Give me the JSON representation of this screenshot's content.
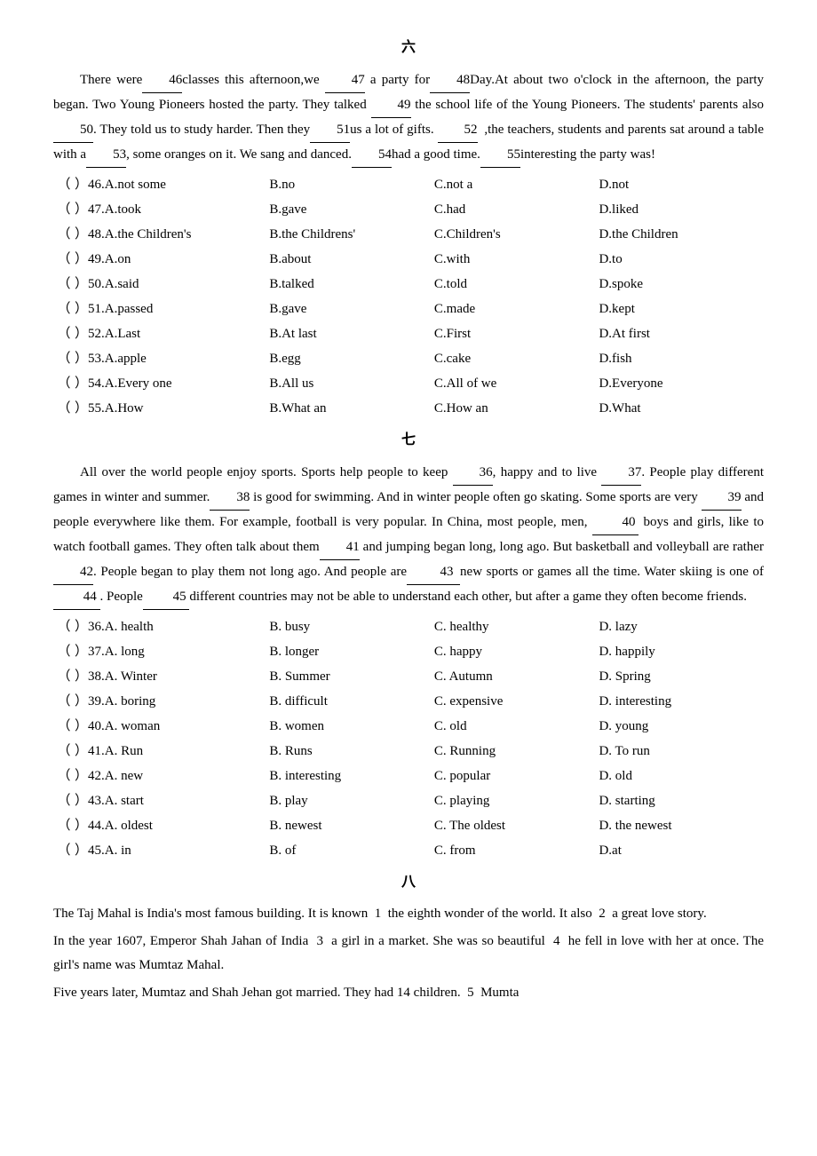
{
  "sections": [
    {
      "id": "liu",
      "title": "六",
      "passage": [
        "There were 46 classes this afternoon,we 47 a party for 48 Day.At about two o'clock in the afternoon, the party began. Two Young Pioneers hosted the party. They talked 49 the school life of the Young Pioneers. The students' parents also 50 . They told us to study harder. Then they 51 us a lot of gifts. 52 ,the teachers, students and parents sat around a table with a 53 , some oranges on it. We sang and danced. 54had a good time. 55 interesting the party was!"
      ],
      "questions": [
        {
          "num": ")46.",
          "options": [
            "A.not some",
            "B.no",
            "C.not a",
            "D.not"
          ]
        },
        {
          "num": ")47.",
          "options": [
            "A.took",
            "B.gave",
            "C.had",
            "D.liked"
          ]
        },
        {
          "num": ")48.",
          "options": [
            "A.the Children's",
            "B.the Childrens'",
            "C.Children's",
            "D.the Children"
          ]
        },
        {
          "num": ")49.",
          "options": [
            "A.on",
            "B.about",
            "C.with",
            "D.to"
          ]
        },
        {
          "num": ")50.",
          "options": [
            "A.said",
            "B.talked",
            "C.told",
            "D.spoke"
          ]
        },
        {
          "num": ")51.",
          "options": [
            "A.passed",
            "B.gave",
            "C.made",
            "D.kept"
          ]
        },
        {
          "num": ")52.",
          "options": [
            "A.Last",
            "B.At last",
            "C.First",
            "D.At first"
          ]
        },
        {
          "num": ")53.",
          "options": [
            "A.apple",
            "B.egg",
            "C.cake",
            "D.fish"
          ]
        },
        {
          "num": ")54.",
          "options": [
            "A.Every one",
            "B.All us",
            "C.All of we",
            "D.Everyone"
          ]
        },
        {
          "num": ")55.",
          "options": [
            "A.How",
            "B.What an",
            "C.How an",
            "D.What"
          ]
        }
      ]
    },
    {
      "id": "qi",
      "title": "七",
      "passage": "All over the world people enjoy sports. Sports help people to keep __36___, happy and to live __37___. People play different games in winter and summer.__38___ is good for swimming. And in winter people often go skating. Some sports are very __39___ and people everywhere like them. For example, football is very popular. In China, most people, men, ___40___ boys and girls, like to watch football games. They often talk about them__41___________ and jumping began long, long ago. But basketball and volleyball are rather __42______. People began to play them not long ago. And people are_____43____ new sports or games all the time. Water skiing is one of ___44___. People___45____ different countries may not be able to understand each other, but after a game they often become friends.",
      "questions": [
        {
          "num": ")36.",
          "options": [
            "A. health",
            "B. busy",
            "C. healthy",
            "D. lazy"
          ]
        },
        {
          "num": ")37.",
          "options": [
            "A. long",
            "B. longer",
            "C. happy",
            "D. happily"
          ]
        },
        {
          "num": ")38.",
          "options": [
            "A. Winter",
            "B. Summer",
            "C. Autumn",
            "D. Spring"
          ]
        },
        {
          "num": ")39.",
          "options": [
            "A. boring",
            "B. difficult",
            "C. expensive",
            "D. interesting"
          ]
        },
        {
          "num": ")40.",
          "options": [
            "A. woman",
            "B. women",
            "C. old",
            "D. young"
          ]
        },
        {
          "num": ")41.",
          "options": [
            "A. Run",
            "B. Runs",
            "C. Running",
            "D. To run"
          ]
        },
        {
          "num": ")42.",
          "options": [
            "A. new",
            "B. interesting",
            "C. popular",
            "D. old"
          ]
        },
        {
          "num": ")43.",
          "options": [
            "A. start",
            "B. play",
            "C. playing",
            "D. starting"
          ]
        },
        {
          "num": ")44.",
          "options": [
            "A. oldest",
            "B. newest",
            "C. The oldest",
            "D. the newest"
          ]
        },
        {
          "num": ")45.",
          "options": [
            "A. in",
            "B. of",
            "C. from",
            "D.at"
          ]
        }
      ]
    },
    {
      "id": "ba",
      "title": "八",
      "passage_lines": [
        "The Taj Mahal is India's most famous building. It is known  1  the eighth wonder of the world. It also  2  a great love story.",
        "In the year 1607, Emperor Shah Jahan of India  3  a girl in a market. She was so beautiful  4  he fell in love with her at once. The girl's name was Mumtaz Mahal.",
        "Five years later, Mumtaz and Shah Jehan got married. They had 14 children.  5  Mumta"
      ]
    }
  ]
}
